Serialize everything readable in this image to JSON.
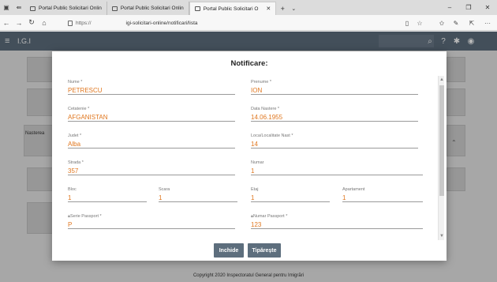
{
  "browser": {
    "tabs": [
      {
        "label": "Portal Public Solicitari Onlin"
      },
      {
        "label": "Portal Public Solicitari Onlin"
      },
      {
        "label": "Portal Public Solicitari O"
      }
    ],
    "url_scheme": "https://",
    "url_path": "igi-solicitari-online/notificari/lista"
  },
  "app": {
    "brand": "I.G.I"
  },
  "background": {
    "left_label": "Nasterea",
    "footer": "Copyright 2020 Inspectoratul General pentru Imigrări"
  },
  "modal": {
    "title": "Notificare:",
    "fields": {
      "nume": {
        "label": "Nume *",
        "value": "PETRESCU"
      },
      "prenume": {
        "label": "Prenume *",
        "value": "ION"
      },
      "cetatenie": {
        "label": "Cetatenie *",
        "value": "AFGANISTAN"
      },
      "data_nastere": {
        "label": "Data Nastere *",
        "value": "14.06.1955"
      },
      "judet": {
        "label": "Judet *",
        "value": "Alba"
      },
      "localitate": {
        "label": "Loca/Localitate Nast *",
        "value": "14"
      },
      "strada": {
        "label": "Strada *",
        "value": "357"
      },
      "numar": {
        "label": "Numar",
        "value": "1"
      },
      "bloc": {
        "label": "Bloc",
        "value": "1"
      },
      "scara": {
        "label": "Scara",
        "value": "1"
      },
      "etaj": {
        "label": "Etaj",
        "value": "1"
      },
      "apartament": {
        "label": "Apartament",
        "value": "1"
      },
      "serie_pasaport": {
        "label": "Serie Passport *",
        "value": "P"
      },
      "numar_pasaport": {
        "label": "Numar Passport *",
        "value": "123"
      }
    },
    "buttons": {
      "close": "Inchide",
      "print": "Tipărește"
    }
  }
}
